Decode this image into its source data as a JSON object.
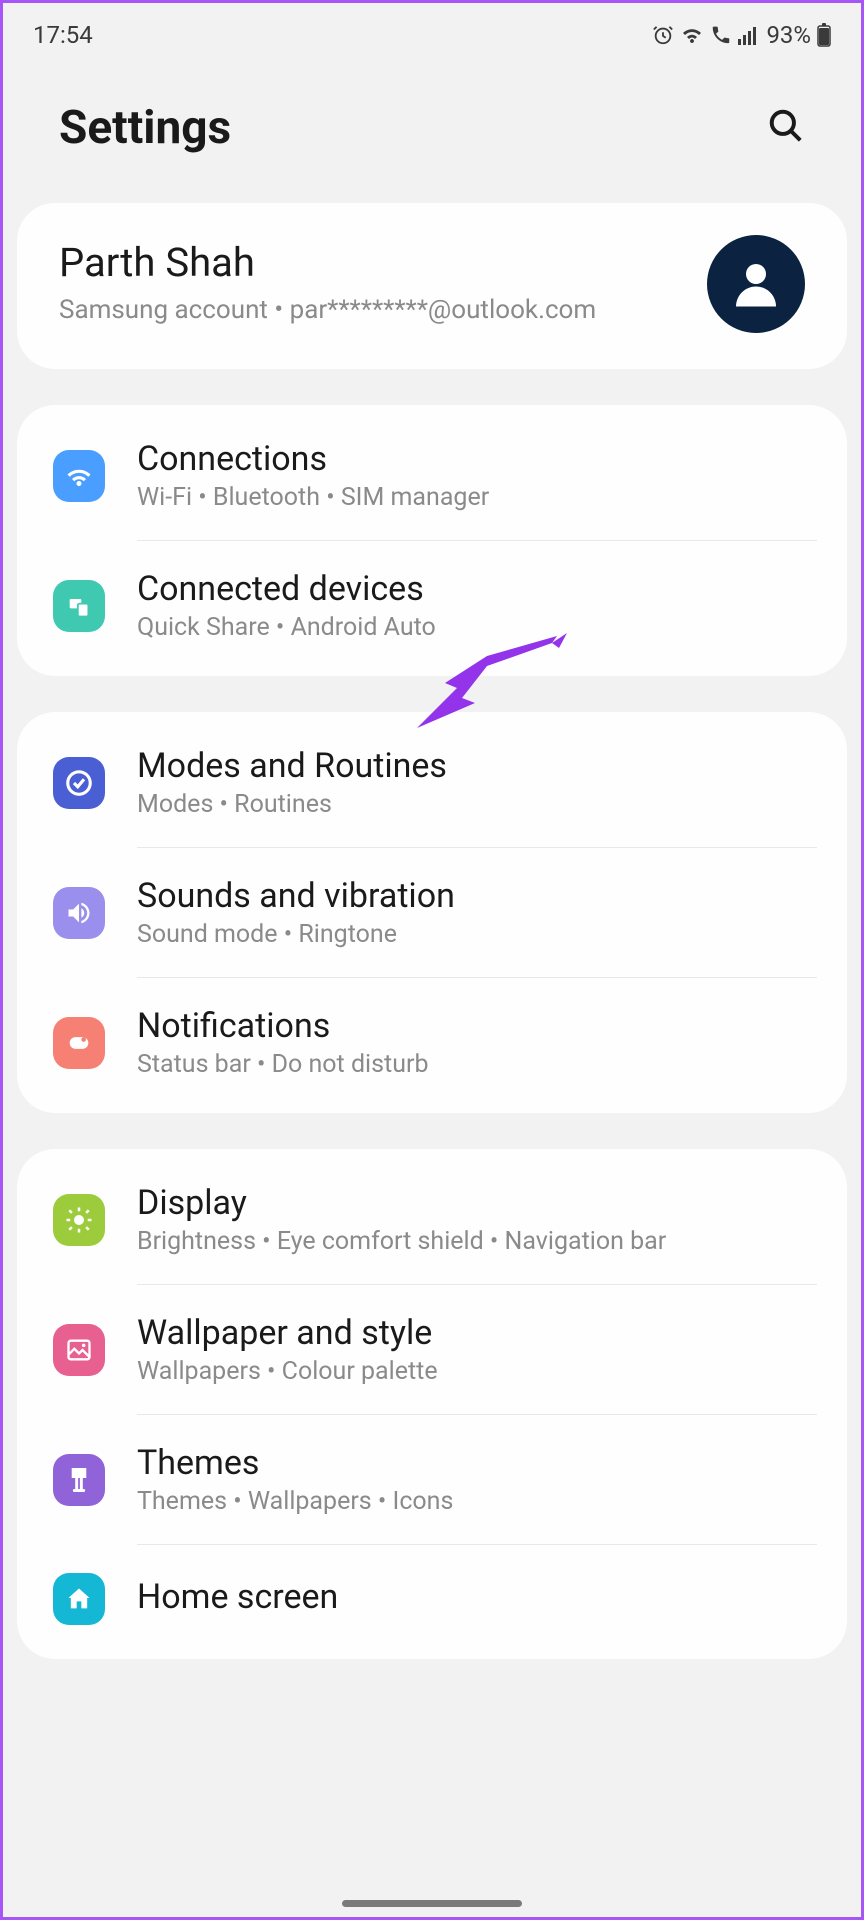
{
  "status_bar": {
    "time": "17:54",
    "battery": "93%"
  },
  "header": {
    "title": "Settings"
  },
  "account": {
    "name": "Parth Shah",
    "detail": "Samsung account  •  par*********@outlook.com"
  },
  "groups": [
    {
      "items": [
        {
          "id": "connections",
          "title": "Connections",
          "subtitle": "Wi-Fi  •  Bluetooth  •  SIM manager",
          "icon": "wifi",
          "color": "bg-blue"
        },
        {
          "id": "connected-devices",
          "title": "Connected devices",
          "subtitle": "Quick Share  •  Android Auto",
          "icon": "devices",
          "color": "bg-teal"
        }
      ]
    },
    {
      "items": [
        {
          "id": "modes-routines",
          "title": "Modes and Routines",
          "subtitle": "Modes  •  Routines",
          "icon": "modes",
          "color": "bg-indigo",
          "arrow": true
        },
        {
          "id": "sounds-vibration",
          "title": "Sounds and vibration",
          "subtitle": "Sound mode  •  Ringtone",
          "icon": "sound",
          "color": "bg-lavender"
        },
        {
          "id": "notifications",
          "title": "Notifications",
          "subtitle": "Status bar  •  Do not disturb",
          "icon": "notifications",
          "color": "bg-coral"
        }
      ]
    },
    {
      "items": [
        {
          "id": "display",
          "title": "Display",
          "subtitle": "Brightness  •  Eye comfort shield  •  Navigation bar",
          "icon": "display",
          "color": "bg-lime"
        },
        {
          "id": "wallpaper",
          "title": "Wallpaper and style",
          "subtitle": "Wallpapers  •  Colour palette",
          "icon": "wallpaper",
          "color": "bg-pink"
        },
        {
          "id": "themes",
          "title": "Themes",
          "subtitle": "Themes  •  Wallpapers  •  Icons",
          "icon": "themes",
          "color": "bg-purple"
        },
        {
          "id": "home-screen",
          "title": "Home screen",
          "subtitle": "",
          "icon": "home",
          "color": "bg-cyan"
        }
      ]
    }
  ]
}
